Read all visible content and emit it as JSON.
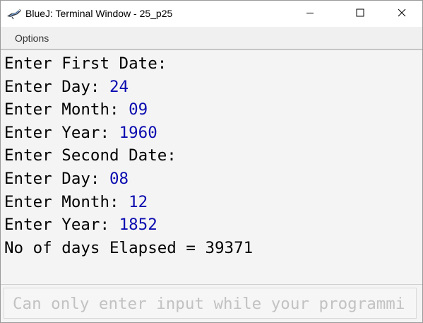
{
  "window": {
    "title": "BlueJ: Terminal Window - 25_p25",
    "app_icon": "bluej-bird-icon",
    "controls": {
      "minimize_icon": "minimize-icon",
      "maximize_icon": "maximize-icon",
      "close_icon": "close-icon"
    }
  },
  "menu": {
    "items": [
      {
        "label": "Options"
      }
    ]
  },
  "terminal": {
    "lines": [
      {
        "prompt": "Enter First Date:",
        "input": ""
      },
      {
        "prompt": "Enter Day: ",
        "input": "24"
      },
      {
        "prompt": "Enter Month: ",
        "input": "09"
      },
      {
        "prompt": "Enter Year: ",
        "input": "1960"
      },
      {
        "prompt": "Enter Second Date:",
        "input": ""
      },
      {
        "prompt": "Enter Day: ",
        "input": "08"
      },
      {
        "prompt": "Enter Month: ",
        "input": "12"
      },
      {
        "prompt": "Enter Year: ",
        "input": "1852"
      },
      {
        "prompt": "No of days Elapsed = 39371",
        "input": ""
      }
    ],
    "colors": {
      "output": "#000000",
      "input": "#0b0bb0"
    }
  },
  "input_area": {
    "placeholder": "Can only enter input while your programmi"
  }
}
